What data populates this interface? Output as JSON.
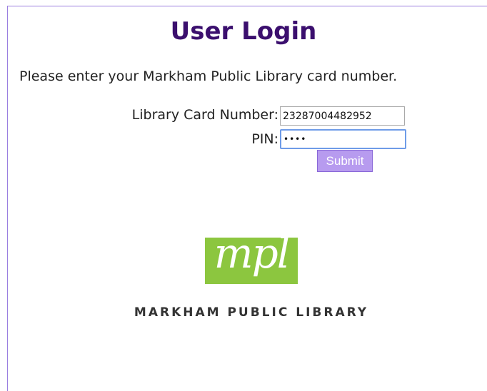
{
  "page": {
    "title": "User Login",
    "instruction": "Please enter your Markham Public Library card number."
  },
  "form": {
    "card_label": "Library Card Number:",
    "card_value": "23287004482952",
    "pin_label": "PIN:",
    "pin_value": "••••",
    "submit_label": "Submit"
  },
  "branding": {
    "logo_text": "mpl",
    "library_name": "MARKHAM PUBLIC LIBRARY",
    "logo_color": "#8cc63f",
    "title_color": "#3b0f6e",
    "button_color": "#b79bef"
  }
}
